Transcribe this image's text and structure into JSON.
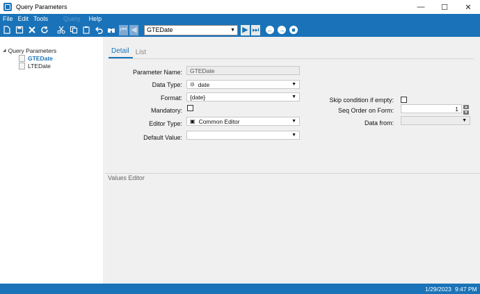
{
  "window": {
    "title": "Query Parameters",
    "controls": {
      "minimize": "—",
      "maximize": "☐",
      "close": "✕"
    }
  },
  "menu": {
    "file": "File",
    "edit": "Edit",
    "tools": "Tools",
    "disabled_item": "Query",
    "help": "Help"
  },
  "toolbar": {
    "current_record": "GTEDate",
    "icons": [
      "new-icon",
      "save-icon",
      "delete-icon",
      "refresh-icon",
      "cut-icon",
      "copy-icon",
      "paste-icon",
      "undo-icon",
      "find-icon",
      "first-icon",
      "prev-icon",
      "next-icon",
      "last-icon",
      "back-icon",
      "forward-icon",
      "home-icon"
    ]
  },
  "tree": {
    "root": "Query Parameters",
    "children": [
      {
        "label": "GTEDate",
        "selected": true
      },
      {
        "label": "LTEDate",
        "selected": false
      }
    ]
  },
  "tabs": [
    {
      "label": "Detail",
      "active": true
    },
    {
      "label": "List",
      "active": false
    }
  ],
  "form": {
    "parameter_name_label": "Parameter Name:",
    "parameter_name_value": "GTEDate",
    "data_type_label": "Data Type:",
    "data_type_value": "date",
    "format_label": "Format:",
    "format_value": "{date}",
    "mandatory_label": "Mandatory:",
    "editor_type_label": "Editor Type:",
    "editor_type_value": "Common Editor",
    "default_value_label": "Default Value:",
    "default_value_value": "",
    "skip_label": "Skip condition if empty:",
    "seq_order_label": "Seq Order on Form:",
    "seq_order_value": "1",
    "data_from_label": "Data from:",
    "data_from_value": ""
  },
  "values_editor": {
    "label": "Values Editor"
  },
  "status": {
    "date": "1/29/2023",
    "time": "9:47 PM"
  },
  "colors": {
    "accent": "#1a73b8",
    "panel": "#f0f0f0"
  }
}
